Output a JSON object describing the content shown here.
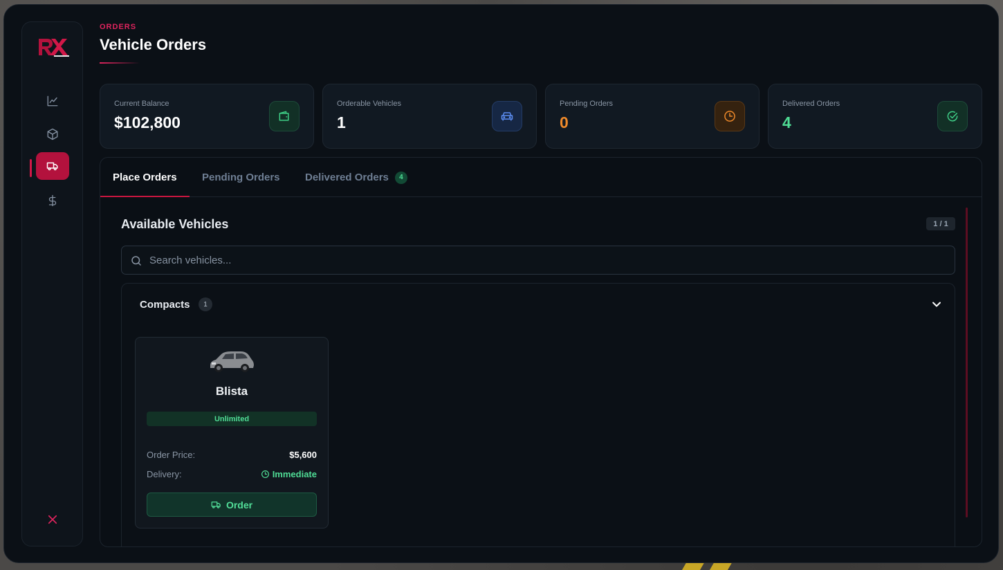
{
  "header": {
    "eyebrow": "ORDERS",
    "title": "Vehicle Orders"
  },
  "sidebar": {
    "items": [
      {
        "icon": "chart-icon"
      },
      {
        "icon": "box-icon"
      },
      {
        "icon": "truck-icon",
        "active": true
      },
      {
        "icon": "dollar-icon"
      }
    ],
    "close_icon": "close-icon"
  },
  "stats": [
    {
      "label": "Current Balance",
      "value": "$102,800",
      "icon": "wallet-icon",
      "color": "#ffffff"
    },
    {
      "label": "Orderable Vehicles",
      "value": "1",
      "icon": "car-icon",
      "color": "#ffffff"
    },
    {
      "label": "Pending Orders",
      "value": "0",
      "icon": "clock-icon",
      "color": "#f08a2a"
    },
    {
      "label": "Delivered Orders",
      "value": "4",
      "icon": "check-circle-icon",
      "color": "#4fdc95"
    }
  ],
  "tabs": [
    {
      "label": "Place Orders",
      "active": true
    },
    {
      "label": "Pending Orders"
    },
    {
      "label": "Delivered Orders",
      "badge": "4"
    }
  ],
  "section": {
    "title": "Available Vehicles",
    "page": "1 / 1"
  },
  "search": {
    "placeholder": "Search vehicles...",
    "value": ""
  },
  "category": {
    "name": "Compacts",
    "count": "1",
    "vehicles": [
      {
        "name": "Blista",
        "stock": "Unlimited",
        "price_label": "Order Price:",
        "price": "$5,600",
        "delivery_label": "Delivery:",
        "delivery": "Immediate",
        "button": "Order"
      }
    ]
  },
  "colors": {
    "accent": "#c8163f",
    "success": "#4fdc95",
    "warning": "#f08a2a",
    "info": "#5b8cf0"
  }
}
